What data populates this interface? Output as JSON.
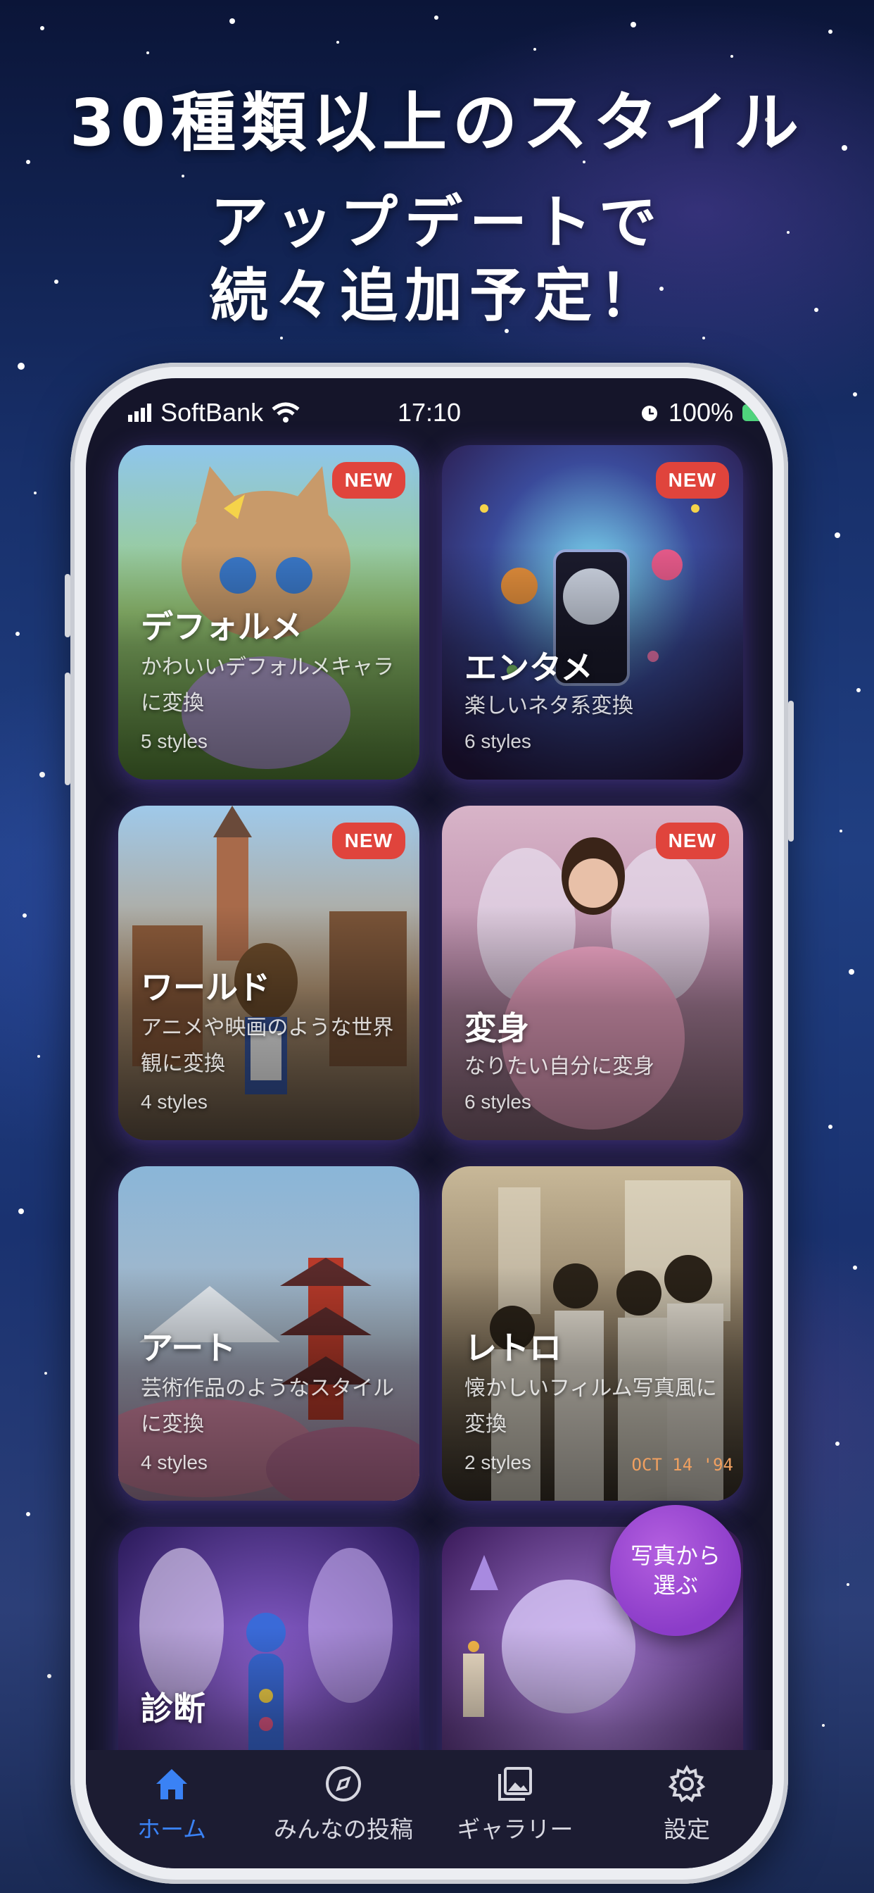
{
  "headline": {
    "line1": "30種類以上のスタイル",
    "line2a": "アップデートで",
    "line2b": "続々追加予定！"
  },
  "status_bar": {
    "carrier": "SoftBank",
    "time": "17:10",
    "battery": "100%"
  },
  "cards": [
    {
      "title": "デフォルメ",
      "desc": "かわいいデフォルメキャラに変換",
      "styles": "5 styles",
      "badge": "NEW",
      "art": "chibi-cat-illustration"
    },
    {
      "title": "エンタメ",
      "desc": "楽しいネタ系変換",
      "styles": "6 styles",
      "badge": "NEW",
      "art": "party-phone-illustration"
    },
    {
      "title": "ワールド",
      "desc": "アニメや映画のような世界観に変換",
      "styles": "4 styles",
      "badge": "NEW",
      "art": "anime-town-illustration"
    },
    {
      "title": "変身",
      "desc": "なりたい自分に変身",
      "styles": "6 styles",
      "badge": "NEW",
      "art": "fairy-girl-photo"
    },
    {
      "title": "アート",
      "desc": "芸術作品のようなスタイルに変換",
      "styles": "4 styles",
      "art": "pagoda-painting"
    },
    {
      "title": "レトロ",
      "desc": "懐かしいフィルム写真風に変換",
      "styles": "2 styles",
      "stamp": "OCT 14 '94",
      "art": "retro-classroom-photo"
    },
    {
      "title": "診断",
      "art": "mystic-aura-illustration"
    },
    {
      "art": "crystal-ball-illustration"
    }
  ],
  "fab": {
    "line1": "写真から",
    "line2": "選ぶ"
  },
  "tabs": [
    {
      "label": "ホーム",
      "icon": "home-icon",
      "active": true
    },
    {
      "label": "みんなの投稿",
      "icon": "compass-icon",
      "active": false
    },
    {
      "label": "ギャラリー",
      "icon": "gallery-icon",
      "active": false
    },
    {
      "label": "設定",
      "icon": "gear-icon",
      "active": false
    }
  ],
  "colors": {
    "active_tab": "#3a82f5",
    "badge": "#e0443c",
    "fab": "#8b3cc8"
  }
}
